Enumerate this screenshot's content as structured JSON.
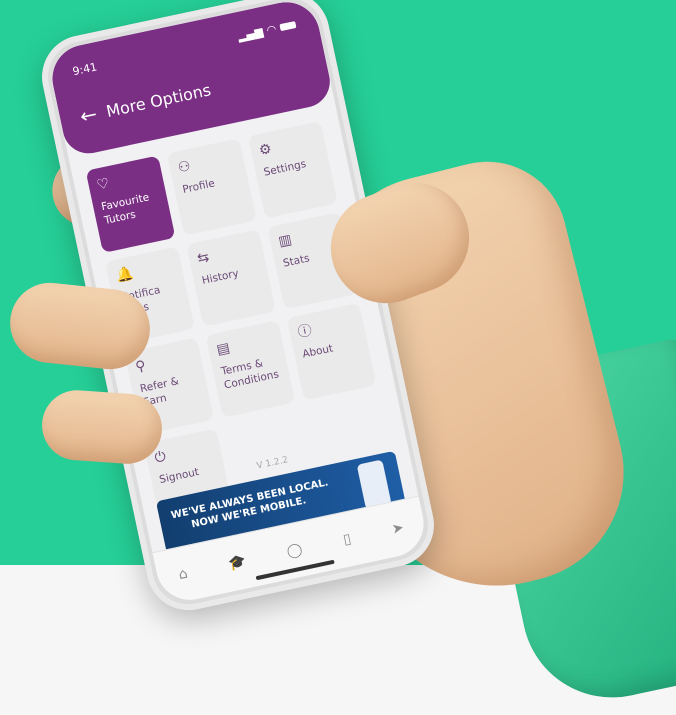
{
  "status": {
    "time": "9:41"
  },
  "header": {
    "title": "More Options"
  },
  "tiles": [
    {
      "label": "Favourite Tutors",
      "icon": "heart-icon",
      "glyph": "♡"
    },
    {
      "label": "Profile",
      "icon": "users-icon",
      "glyph": "⚇"
    },
    {
      "label": "Settings",
      "icon": "gear-icon",
      "glyph": "⚙"
    },
    {
      "label": "Notifica tions",
      "icon": "bell-icon",
      "glyph": "🔔"
    },
    {
      "label": "History",
      "icon": "swap-arrows-icon",
      "glyph": "⇆"
    },
    {
      "label": "Stats",
      "icon": "bar-chart-icon",
      "glyph": "▥"
    },
    {
      "label": "Refer & Earn",
      "icon": "user-plus-icon",
      "glyph": "⚲"
    },
    {
      "label": "Terms & Conditions",
      "icon": "document-icon",
      "glyph": "▤"
    },
    {
      "label": "About",
      "icon": "info-icon",
      "glyph": "ⓘ"
    },
    {
      "label": "Signout",
      "icon": "power-icon",
      "glyph": "⏻"
    }
  ],
  "active_tile_index": 0,
  "version": "V 1.2.2",
  "banner": {
    "line1": "WE'VE ALWAYS BEEN LOCAL.",
    "line2": "NOW WE'RE MOBILE."
  },
  "tabbar": [
    {
      "icon": "home-icon",
      "glyph": "⌂"
    },
    {
      "icon": "graduation-cap-icon",
      "glyph": "🎓"
    },
    {
      "icon": "chat-icon",
      "glyph": "◯"
    },
    {
      "icon": "book-icon",
      "glyph": "▯"
    },
    {
      "icon": "send-icon",
      "glyph": "➤"
    }
  ],
  "active_tab_index": 1,
  "colors": {
    "accent": "#7a2e84",
    "background": "#26cf97"
  }
}
